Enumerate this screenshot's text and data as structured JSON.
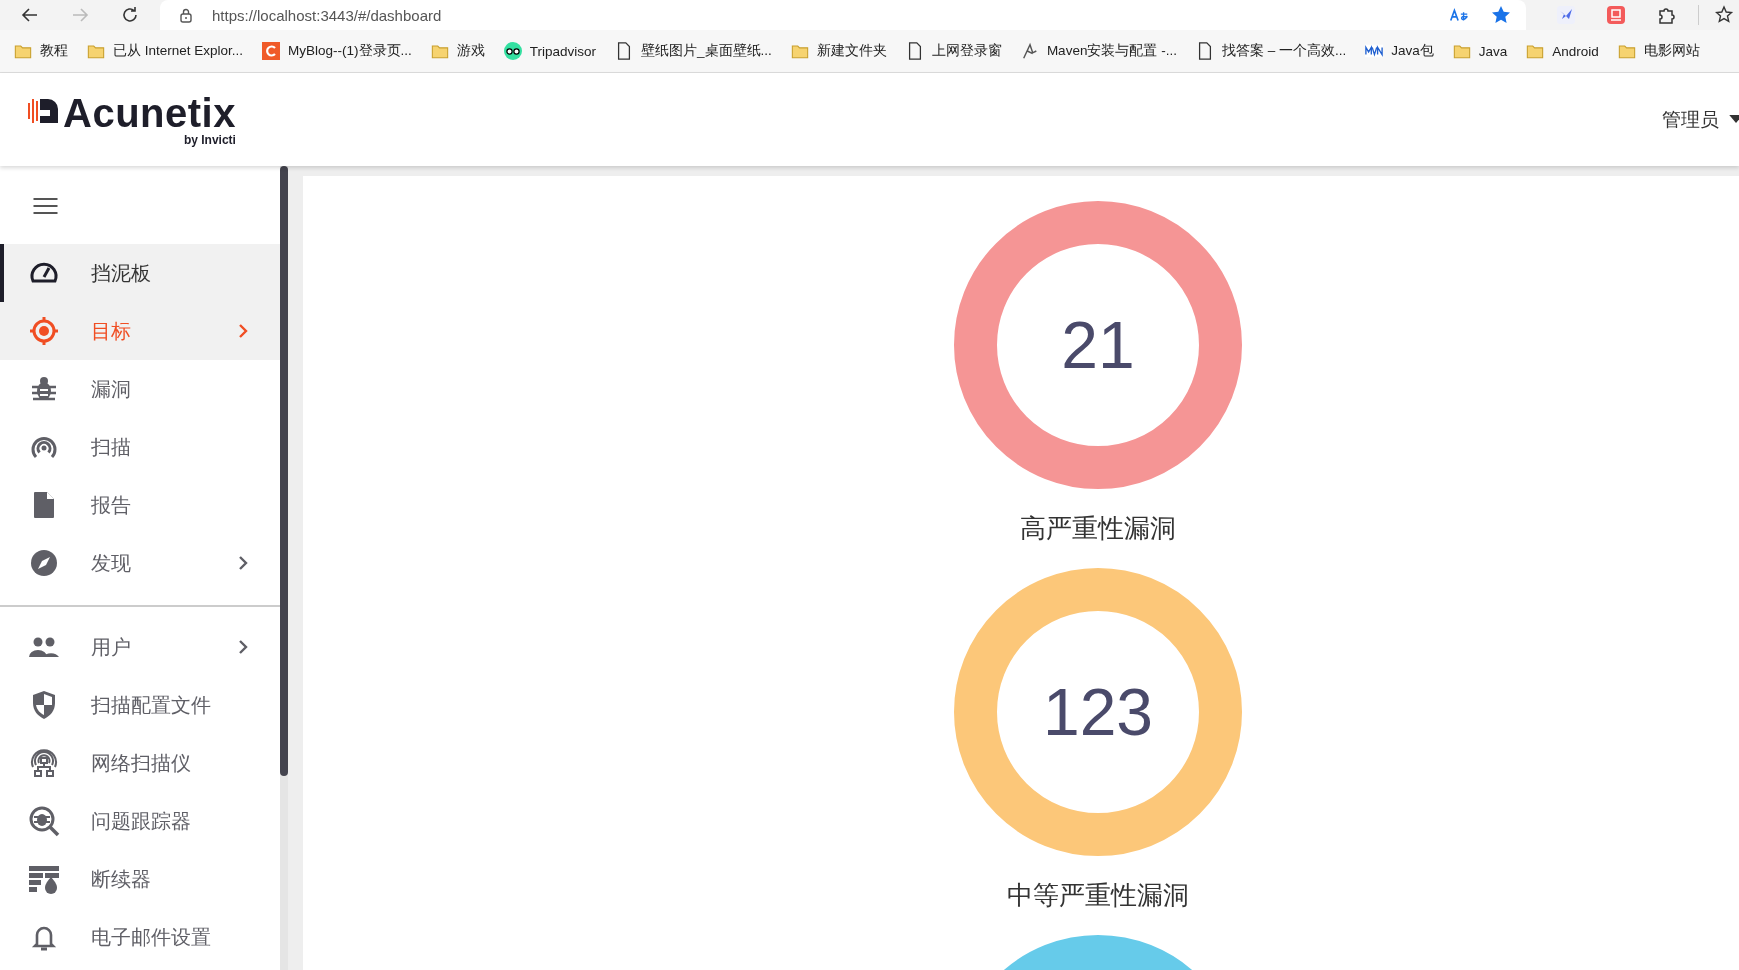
{
  "browser": {
    "url": "https://localhost:3443/#/dashboard",
    "forward_disabled": true,
    "bookmarks": [
      {
        "kind": "folder",
        "label": "教程"
      },
      {
        "kind": "folder",
        "label": "已从 Internet Explor..."
      },
      {
        "kind": "blog",
        "label": "MyBlog--(1)登录页..."
      },
      {
        "kind": "folder",
        "label": "游戏"
      },
      {
        "kind": "owl",
        "label": "Tripadvisor"
      },
      {
        "kind": "page",
        "label": "壁纸图片_桌面壁纸..."
      },
      {
        "kind": "folder",
        "label": "新建文件夹"
      },
      {
        "kind": "page",
        "label": "上网登录窗"
      },
      {
        "kind": "feather",
        "label": "Maven安装与配置 -..."
      },
      {
        "kind": "page",
        "label": "找答案 – 一个高效..."
      },
      {
        "kind": "mvn",
        "label": "Java包"
      },
      {
        "kind": "folder",
        "label": "Java"
      },
      {
        "kind": "folder",
        "label": "Android"
      },
      {
        "kind": "folder",
        "label": "电影网站"
      }
    ]
  },
  "header": {
    "brand": "Acunetix",
    "brand_sub": "by Invicti",
    "user": "管理员"
  },
  "sidebar": {
    "groups": [
      [
        {
          "kind": "gauge",
          "label": "挡泥板",
          "selected": true,
          "hovered": false,
          "expandable": false
        },
        {
          "kind": "target",
          "label": "目标",
          "selected": false,
          "hovered": true,
          "expandable": true
        },
        {
          "kind": "bug",
          "label": "漏洞",
          "selected": false,
          "hovered": false,
          "expandable": false
        },
        {
          "kind": "scan",
          "label": "扫描",
          "selected": false,
          "hovered": false,
          "expandable": false
        },
        {
          "kind": "file",
          "label": "报告",
          "selected": false,
          "hovered": false,
          "expandable": false
        },
        {
          "kind": "compass",
          "label": "发现",
          "selected": false,
          "hovered": false,
          "expandable": true
        }
      ],
      [
        {
          "kind": "users",
          "label": "用户",
          "selected": false,
          "hovered": false,
          "expandable": true
        },
        {
          "kind": "shield",
          "label": "扫描配置文件",
          "selected": false,
          "hovered": false,
          "expandable": false
        },
        {
          "kind": "network",
          "label": "网络扫描仪",
          "selected": false,
          "hovered": false,
          "expandable": false
        },
        {
          "kind": "bugsearch",
          "label": "问题跟踪器",
          "selected": false,
          "hovered": false,
          "expandable": false
        },
        {
          "kind": "firewall",
          "label": "断续器",
          "selected": false,
          "hovered": false,
          "expandable": false
        },
        {
          "kind": "bell",
          "label": "电子邮件设置",
          "selected": false,
          "hovered": false,
          "expandable": false
        }
      ]
    ]
  },
  "stats": [
    {
      "value": "21",
      "label": "高严重性漏洞",
      "color": "#f59595"
    },
    {
      "value": "123",
      "label": "中等严重性漏洞",
      "color": "#fcc779"
    },
    {
      "color": "#66cbea"
    }
  ]
}
